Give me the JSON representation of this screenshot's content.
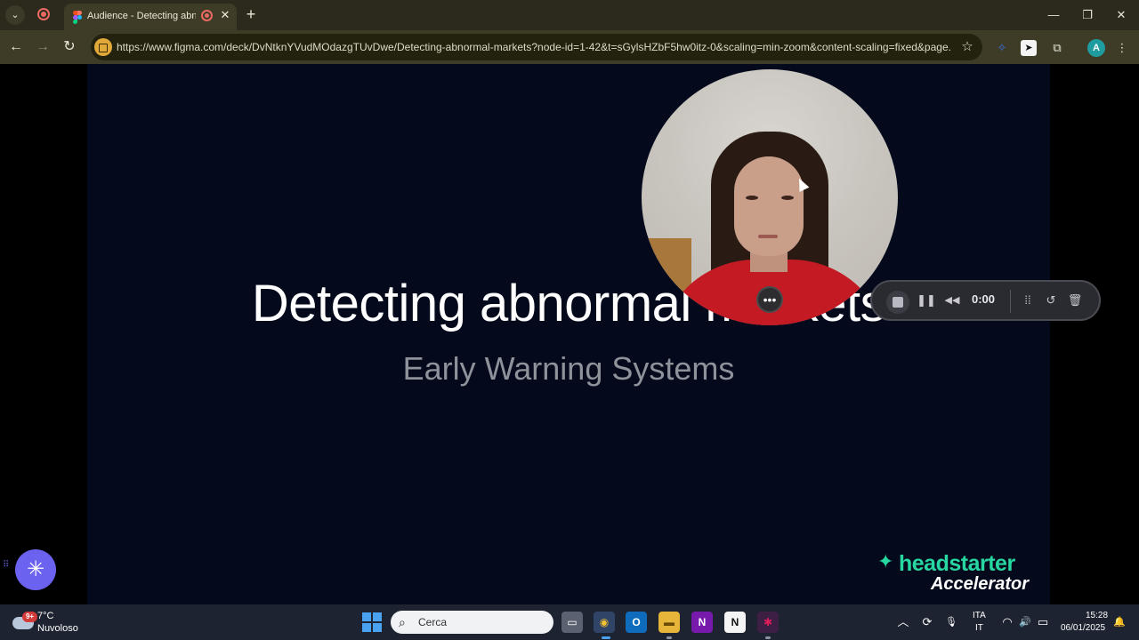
{
  "browser": {
    "tab": {
      "title": "Audience - Detecting abnormal markets",
      "close_glyph": "✕"
    },
    "new_tab_glyph": "+",
    "tab_menu_glyph": "⌄",
    "window": {
      "minimize": "—",
      "restore": "❐",
      "close": "✕"
    },
    "nav": {
      "back": "←",
      "forward": "→",
      "reload": "↻"
    },
    "url": "https://www.figma.com/deck/DvNtknYVudMOdazgTUvDwe/Detecting-abnormal-markets?node-id=1-42&t=sGylsHZbF5hw0itz-0&scaling=min-zoom&content-scaling=fixed&page...",
    "bookmark_glyph": "☆",
    "extensions": {
      "puzzle": "⧉",
      "menu": "⋮"
    },
    "profile_initial": "A"
  },
  "slide": {
    "title": "Detecting abnormal markets",
    "subtitle": "Early Warning Systems",
    "logo": {
      "star": "✦",
      "word": "headstarter",
      "sub": "Accelerator"
    }
  },
  "recorder": {
    "more_glyph": "•••",
    "time": "0:00",
    "pause_glyph": "❚❚",
    "rewind_glyph": "◀◀",
    "grid_glyph": "⁞⁞",
    "restart_glyph": "↺",
    "delete_glyph": "🗑"
  },
  "widget": {
    "glyph": "✳",
    "dots": "⠿"
  },
  "taskbar": {
    "weather": {
      "badge": "9+",
      "temp": "7°C",
      "desc": "Nuvoloso"
    },
    "search_placeholder": "Cerca",
    "apps": [
      {
        "label": "▭"
      },
      {
        "label": "◉"
      },
      {
        "label": "O"
      },
      {
        "label": "▬"
      },
      {
        "label": "N"
      },
      {
        "label": "N"
      },
      {
        "label": "✱"
      }
    ],
    "tray": {
      "chevron": "︿",
      "sync": "⟳",
      "mic": "🎙",
      "wifi": "◠",
      "volume": "🔊",
      "battery": "▭",
      "notify": "🔔"
    },
    "language": {
      "line1": "ITA",
      "line2": "IT"
    },
    "clock": {
      "time": "15:28",
      "date": "06/01/2025"
    }
  },
  "colors": {
    "slide_bg": "#040a1c",
    "accent_green": "#27d6a0",
    "recorder_bg": "#2a2b30",
    "widget_purple": "#6c62f0"
  }
}
